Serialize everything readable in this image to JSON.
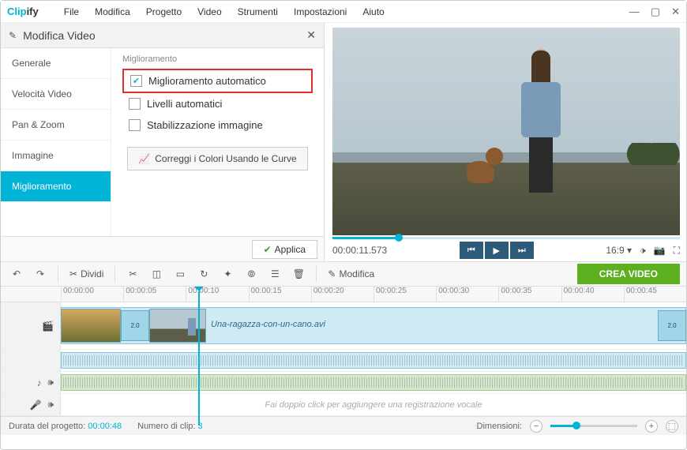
{
  "app": {
    "brand_left": "Clip",
    "brand_right": "ify"
  },
  "menus": [
    "File",
    "Modifica",
    "Progetto",
    "Video",
    "Strumenti",
    "Impostazioni",
    "Aiuto"
  ],
  "edit_panel": {
    "title": "Modifica Video",
    "tabs": [
      "Generale",
      "Velocità Video",
      "Pan & Zoom",
      "Immagine",
      "Miglioramento"
    ],
    "group_label": "Miglioramento",
    "opts": {
      "auto_enhance": "Miglioramento automatico",
      "auto_levels": "Livelli automatici",
      "stabilize": "Stabilizzazione immagine"
    },
    "curves_btn": "Correggi i Colori Usando le Curve",
    "apply": "Applica"
  },
  "preview": {
    "time": "00:00:11.573",
    "aspect": "16:9"
  },
  "toolbar": {
    "split": "Dividi",
    "edit": "Modifica",
    "create": "CREA VIDEO"
  },
  "ruler": [
    "00:00:00",
    "00:00:05",
    "00:00:10",
    "00:00:15",
    "00:00:20",
    "00:00:25",
    "00:00:30",
    "00:00:35",
    "00:00:40",
    "00:00:45"
  ],
  "timeline": {
    "clip_label": "Una-ragazza-con-un-cano.avi",
    "trans": "2.0",
    "mic_placeholder": "Fai doppio click per aggiungere una registrazione vocale"
  },
  "status": {
    "duration_lbl": "Durata del progetto:",
    "duration_val": "00:00:48",
    "clips_lbl": "Numero di clip:",
    "clips_val": "3",
    "zoom_lbl": "Dimensioni:"
  }
}
